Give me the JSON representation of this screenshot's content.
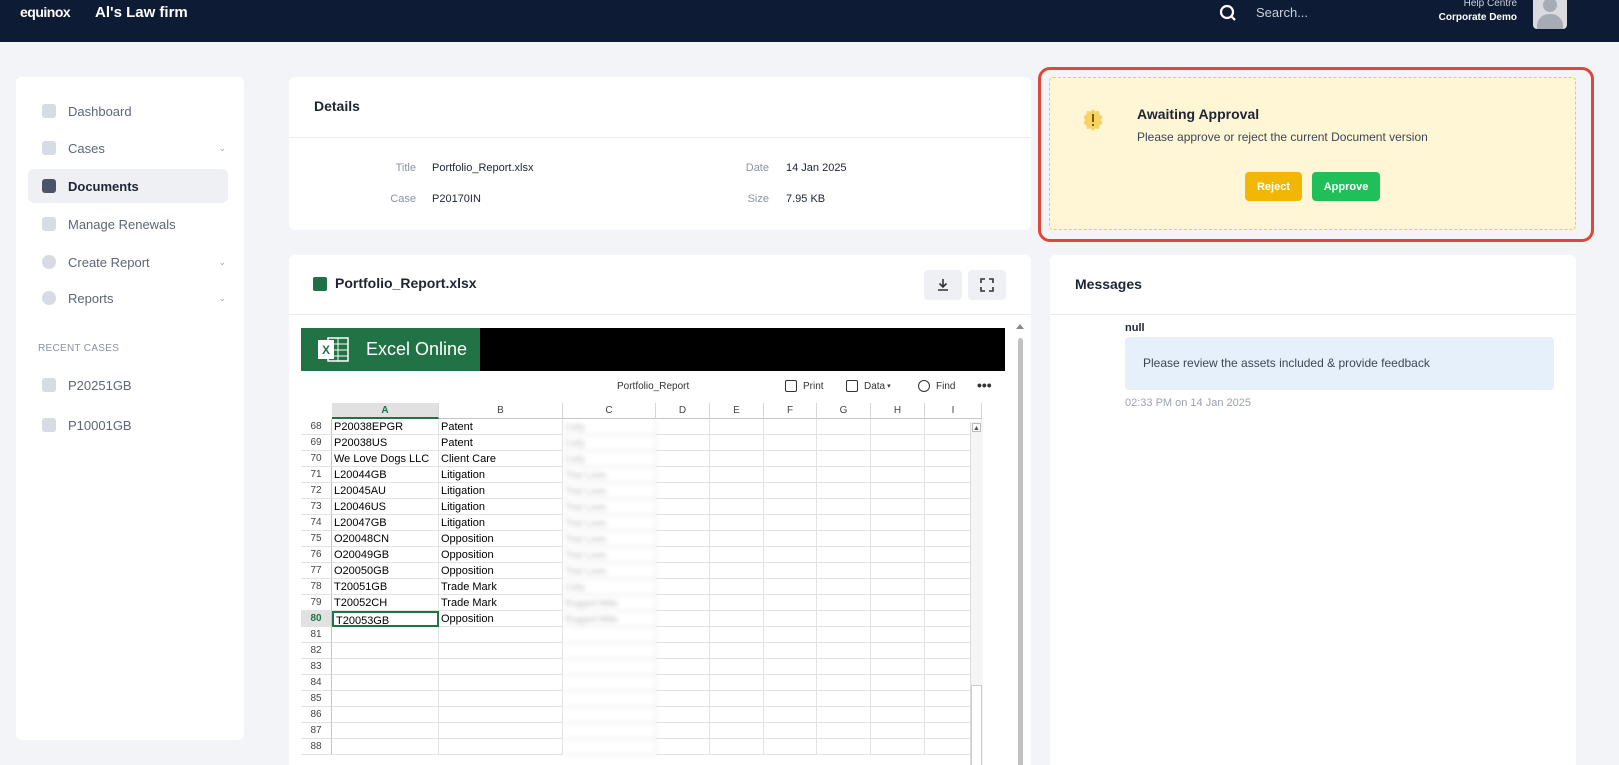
{
  "header": {
    "logo": "equinox",
    "firm_name": "Al's Law firm",
    "search_placeholder": "Search...",
    "help_link": "Help Centre",
    "account_name": "Corporate Demo"
  },
  "sidebar": {
    "items": [
      {
        "label": "Dashboard",
        "icon": "dashboard-icon"
      },
      {
        "label": "Cases",
        "icon": "cases-icon",
        "chevron": "⌄"
      },
      {
        "label": "Documents",
        "icon": "documents-icon"
      },
      {
        "label": "Manage Renewals",
        "icon": "renewals-icon"
      },
      {
        "label": "Create Report",
        "icon": "plus-icon",
        "chevron": "⌄"
      },
      {
        "label": "Reports",
        "icon": "pie-chart-icon",
        "chevron": "⌄"
      }
    ],
    "recent_title": "RECENT CASES",
    "recent_cases": [
      "P20251GB",
      "P10001GB"
    ]
  },
  "details": {
    "title": "Details",
    "fields": {
      "title_label": "Title",
      "title_value": "Portfolio_Report.xlsx",
      "case_label": "Case",
      "case_value": "P20170IN",
      "date_label": "Date",
      "date_value": "14 Jan 2025",
      "size_label": "Size",
      "size_value": "7.95 KB"
    }
  },
  "approval": {
    "title": "Awaiting Approval",
    "subtitle": "Please approve or reject the current Document version",
    "reject_label": "Reject",
    "approve_label": "Approve",
    "accent_color": "#e0473a"
  },
  "viewer": {
    "file_name": "Portfolio_Report.xlsx",
    "excel": {
      "brand": "Excel Online",
      "doc_name": "Portfolio_Report",
      "tools": [
        "Print",
        "Data",
        "Find"
      ],
      "more": "•••",
      "columns": [
        "A",
        "B",
        "C",
        "D",
        "E",
        "F",
        "G",
        "H",
        "I"
      ],
      "selected_column": "A",
      "rows": [
        {
          "n": "68",
          "a": "P20038EPGR",
          "b": "Patent",
          "c": "Colly"
        },
        {
          "n": "69",
          "a": "P20038US",
          "b": "Patent",
          "c": "Colly"
        },
        {
          "n": "70",
          "a": "We Love Dogs LLC",
          "b": "Client Care",
          "c": "Colly"
        },
        {
          "n": "71",
          "a": "L20044GB",
          "b": "Litigation",
          "c": "Thel Lowe"
        },
        {
          "n": "72",
          "a": "L20045AU",
          "b": "Litigation",
          "c": "Thel Lowe"
        },
        {
          "n": "73",
          "a": "L20046US",
          "b": "Litigation",
          "c": "Thel Lowe"
        },
        {
          "n": "74",
          "a": "L20047GB",
          "b": "Litigation",
          "c": "Thel Lowe"
        },
        {
          "n": "75",
          "a": "O20048CN",
          "b": "Opposition",
          "c": "Thel Lowe"
        },
        {
          "n": "76",
          "a": "O20049GB",
          "b": "Opposition",
          "c": "Thel Lowe"
        },
        {
          "n": "77",
          "a": "O20050GB",
          "b": "Opposition",
          "c": "Thel Lowe"
        },
        {
          "n": "78",
          "a": "T20051GB",
          "b": "Trade Mark",
          "c": "Colly"
        },
        {
          "n": "79",
          "a": "T20052CH",
          "b": "Trade Mark",
          "c": "Rugged Milla"
        },
        {
          "n": "80",
          "a": "T20053GB",
          "b": "Opposition",
          "c": "Rugged Milla"
        },
        {
          "n": "81",
          "a": "",
          "b": "",
          "c": ""
        },
        {
          "n": "82",
          "a": "",
          "b": "",
          "c": ""
        },
        {
          "n": "83",
          "a": "",
          "b": "",
          "c": ""
        },
        {
          "n": "84",
          "a": "",
          "b": "",
          "c": ""
        },
        {
          "n": "85",
          "a": "",
          "b": "",
          "c": ""
        },
        {
          "n": "86",
          "a": "",
          "b": "",
          "c": ""
        },
        {
          "n": "87",
          "a": "",
          "b": "",
          "c": ""
        },
        {
          "n": "88",
          "a": "",
          "b": "",
          "c": ""
        }
      ],
      "active_row": "80"
    }
  },
  "messages": {
    "title": "Messages",
    "items": [
      {
        "author": "null",
        "text": "Please review the assets included & provide feedback",
        "time": "02:33 PM on 14 Jan 2025"
      }
    ]
  }
}
